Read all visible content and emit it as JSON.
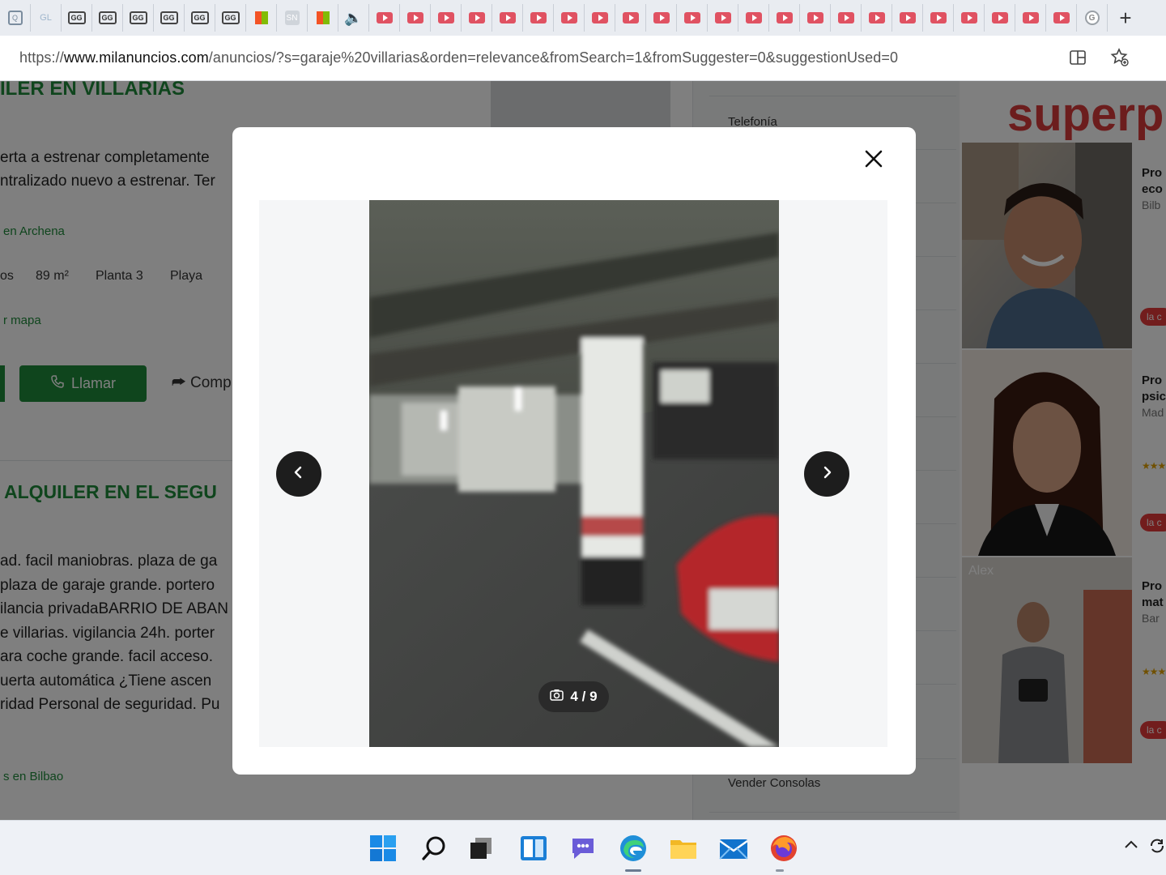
{
  "browser": {
    "tab_favicons": [
      "s1",
      "s2",
      "gc",
      "gc",
      "gc",
      "gc",
      "gc",
      "gc",
      "ms",
      "sn",
      "ms",
      "spk",
      "yt",
      "yt",
      "yt",
      "yt",
      "yt",
      "yt",
      "yt",
      "yt",
      "yt",
      "yt",
      "yt",
      "yt",
      "yt",
      "yt",
      "yt",
      "yt",
      "yt",
      "yt",
      "yt",
      "yt",
      "yt",
      "yt",
      "yt",
      "g"
    ],
    "new_tab_label": "+",
    "url_prefix": "https://",
    "url_domain": "www.milanuncios.com",
    "url_path": "/anuncios/?s=garaje%20villarias&orden=relevance&fromSearch=1&fromSuggester=0&suggestionUsed=0"
  },
  "background": {
    "listing1": {
      "title": "ILER EN VILLARIAS",
      "desc_lines": [
        "erta a estrenar completamente",
        "ntralizado nuevo a estrenar. Ter"
      ],
      "location": "en Archena",
      "features": [
        "os",
        "89 m²",
        "Planta 3",
        "Playa"
      ],
      "map_link": "r mapa",
      "call_label": "Llamar",
      "share_label": "Comp"
    },
    "listing2": {
      "title": "ALQUILER EN EL SEGU",
      "desc_lines": [
        "ad. facil maniobras. plaza de ga",
        "plaza de garaje grande. portero",
        "ilancia privadaBARRIO DE ABAN",
        "e villarias. vigilancia 24h. porter",
        "ara coche grande. facil acceso. ",
        "uerta automática ¿Tiene ascen",
        "ridad Personal de seguridad. Pu"
      ],
      "location": "s en Bilbao"
    },
    "sidebar_menu": [
      "Telefonía",
      "Vender Consolas"
    ],
    "ads": {
      "title": "superp",
      "tiles": [
        {
          "line1": "Pro",
          "line2": "eco",
          "sub": "Bilb",
          "pill": "la c",
          "name": ""
        },
        {
          "line1": "Pro",
          "line2": "psic",
          "sub": "Mad",
          "pill": "la c",
          "name": ""
        },
        {
          "line1": "Pro",
          "line2": "mat",
          "sub": "Bar",
          "pill": "la c",
          "name": "Alex"
        }
      ]
    }
  },
  "modal": {
    "counter_current": "4",
    "counter_total": "9",
    "counter_separator": "/"
  },
  "taskbar": {
    "icons": [
      "windows-start",
      "search",
      "task-view",
      "widgets",
      "chat",
      "edge",
      "file-explorer",
      "mail",
      "firefox"
    ]
  },
  "colors": {
    "brand_green": "#1f8a3b",
    "ad_red": "#d93a3a",
    "overlay": "rgba(0,0,0,0.5)"
  }
}
